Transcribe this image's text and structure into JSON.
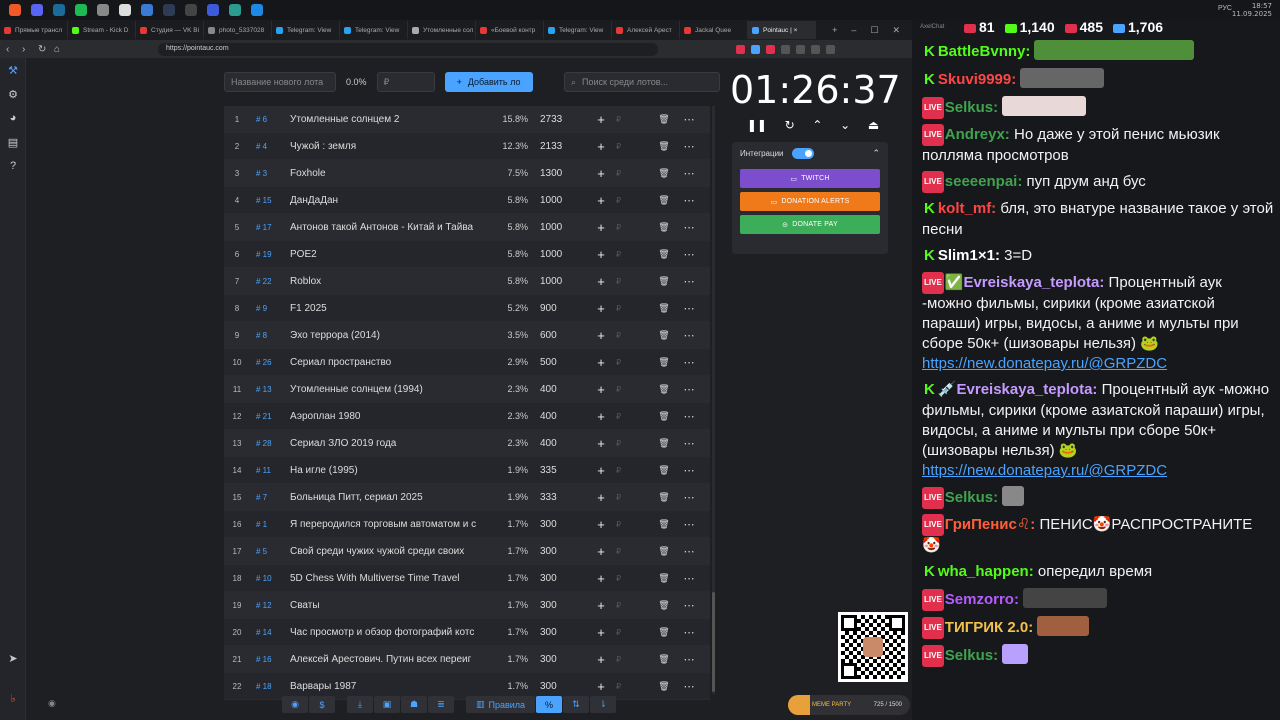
{
  "taskbar": {
    "lang": "РУС",
    "time": "18:57",
    "date": "11.09.2025",
    "icons": [
      {
        "name": "brave-icon",
        "color": "#f05a28"
      },
      {
        "name": "discord-icon",
        "color": "#5865f2"
      },
      {
        "name": "steam-icon",
        "color": "#1b6a9c"
      },
      {
        "name": "spotify-icon",
        "color": "#1db954"
      },
      {
        "name": "app-icon",
        "color": "#888"
      },
      {
        "name": "close-app-icon",
        "color": "#ddd"
      },
      {
        "name": "app-icon",
        "color": "#3a7bd5"
      },
      {
        "name": "app-icon",
        "color": "#2e3b55"
      },
      {
        "name": "app-icon",
        "color": "#444"
      },
      {
        "name": "app-icon",
        "color": "#3b5bdb"
      },
      {
        "name": "app-icon",
        "color": "#2a9d8f"
      },
      {
        "name": "app-icon",
        "color": "#1e88e5"
      }
    ]
  },
  "browser": {
    "tabs": [
      {
        "label": "Прямые трансл",
        "color": "#e53935"
      },
      {
        "label": "Stream - Kick D",
        "color": "#53fc18"
      },
      {
        "label": "Студия — VK Ві",
        "color": "#e53935"
      },
      {
        "label": "photo_5337028",
        "color": "#888"
      },
      {
        "label": "Telegram: View",
        "color": "#2aa3ef"
      },
      {
        "label": "Telegram: View",
        "color": "#2aa3ef"
      },
      {
        "label": "Утомленные сол",
        "color": "#aaa"
      },
      {
        "label": "«Боевой контр",
        "color": "#e53935"
      },
      {
        "label": "Telegram: View",
        "color": "#2aa3ef"
      },
      {
        "label": "Алексей Арест",
        "color": "#e53935"
      },
      {
        "label": "Jackal Quee",
        "color": "#e53935"
      },
      {
        "label": "Pointauc | ×",
        "color": "#4aa3ff"
      }
    ],
    "url": "https://pointauc.com"
  },
  "auction": {
    "new_lot_placeholder": "Название нового лота",
    "pct": "0.0%",
    "amount_placeholder": "₽",
    "add_label": "Добавить ло",
    "search_placeholder": "Поиск среди лотов...",
    "currency": "₽",
    "lots": [
      {
        "idx": "1",
        "id": "# 6",
        "name": "Утомленные солнцем 2",
        "pct": "15.8%",
        "amount": "2733"
      },
      {
        "idx": "2",
        "id": "# 4",
        "name": "Чужой : земля",
        "pct": "12.3%",
        "amount": "2133"
      },
      {
        "idx": "3",
        "id": "# 3",
        "name": "Foxhole",
        "pct": "7.5%",
        "amount": "1300"
      },
      {
        "idx": "4",
        "id": "# 15",
        "name": "ДанДаДан",
        "pct": "5.8%",
        "amount": "1000"
      },
      {
        "idx": "5",
        "id": "# 17",
        "name": "Антонов такой Антонов - Китай и Тайва",
        "pct": "5.8%",
        "amount": "1000"
      },
      {
        "idx": "6",
        "id": "# 19",
        "name": "POE2",
        "pct": "5.8%",
        "amount": "1000"
      },
      {
        "idx": "7",
        "id": "# 22",
        "name": "Roblox",
        "pct": "5.8%",
        "amount": "1000"
      },
      {
        "idx": "8",
        "id": "# 9",
        "name": "F1 2025",
        "pct": "5.2%",
        "amount": "900"
      },
      {
        "idx": "9",
        "id": "# 8",
        "name": "Эхо террора (2014)",
        "pct": "3.5%",
        "amount": "600"
      },
      {
        "idx": "10",
        "id": "# 26",
        "name": "Сериал пространство",
        "pct": "2.9%",
        "amount": "500"
      },
      {
        "idx": "11",
        "id": "# 13",
        "name": "Утомленные солнцем (1994)",
        "pct": "2.3%",
        "amount": "400"
      },
      {
        "idx": "12",
        "id": "# 21",
        "name": "Аэроплан 1980",
        "pct": "2.3%",
        "amount": "400"
      },
      {
        "idx": "13",
        "id": "# 28",
        "name": "Сериал ЗЛО 2019 года",
        "pct": "2.3%",
        "amount": "400"
      },
      {
        "idx": "14",
        "id": "# 11",
        "name": "На игле (1995)",
        "pct": "1.9%",
        "amount": "335"
      },
      {
        "idx": "15",
        "id": "# 7",
        "name": "Больница Питт, сериал 2025",
        "pct": "1.9%",
        "amount": "333"
      },
      {
        "idx": "16",
        "id": "# 1",
        "name": "Я переродился торговым автоматом и с",
        "pct": "1.7%",
        "amount": "300"
      },
      {
        "idx": "17",
        "id": "# 5",
        "name": "Свой среди чужих чужой среди своих",
        "pct": "1.7%",
        "amount": "300"
      },
      {
        "idx": "18",
        "id": "# 10",
        "name": "5D Chess With Multiverse Time Travel",
        "pct": "1.7%",
        "amount": "300"
      },
      {
        "idx": "19",
        "id": "# 12",
        "name": "Сваты",
        "pct": "1.7%",
        "amount": "300"
      },
      {
        "idx": "20",
        "id": "# 14",
        "name": "Час просмотр и обзор фотографий котс",
        "pct": "1.7%",
        "amount": "300"
      },
      {
        "idx": "21",
        "id": "# 16",
        "name": "Алексей Арестович. Путин всех переиг",
        "pct": "1.7%",
        "amount": "300"
      },
      {
        "idx": "22",
        "id": "# 18",
        "name": "Варвары 1987",
        "pct": "1.7%",
        "amount": "300"
      }
    ],
    "timer": "01:26:37",
    "integrations_label": "Интеграции",
    "twitch_label": "TWITCH",
    "donation_alerts_label": "DONATION ALERTS",
    "donatepay_label": "DONATE PAY",
    "rules_label": "Правила",
    "percent_label": "%",
    "meme_label": "MEME PARTY",
    "meme_count": "725 / 1500",
    "colors": {
      "accent": "#4aa3ff",
      "twitch": "#7c4dcc",
      "donation_alerts": "#f07a1a",
      "donatepay": "#3cae5a"
    }
  },
  "chat": {
    "app_label": "AxelChat",
    "stats": [
      {
        "value": "81",
        "color": "#e0304e"
      },
      {
        "value": "1,140",
        "color": "#53fc18"
      },
      {
        "value": "485",
        "color": "#e0304e"
      },
      {
        "value": "1,706",
        "color": "#4aa3ff"
      }
    ],
    "live_badge": "LIVE",
    "kick_badge": "K",
    "messages": [
      {
        "platform": "kick",
        "user": "BattleBvnny:",
        "color": "#53fc18",
        "text": "",
        "emote": "#4f8f3a",
        "emote_w": 160
      },
      {
        "platform": "kick",
        "user": "Skuvi9999:",
        "color": "#ff4545",
        "text": "",
        "emote": "#666",
        "emote_w": 84
      },
      {
        "platform": "live",
        "user": "Selkus:",
        "color": "#3fa34d",
        "text": "",
        "emote": "#e8d8d8",
        "emote_w": 84
      },
      {
        "platform": "live",
        "user": "Andreyx:",
        "color": "#3fa34d",
        "text": "Но даже у этой пенис мьюзик полляма просмотров"
      },
      {
        "platform": "live",
        "user": "seeeenpai:",
        "color": "#3fa34d",
        "text": "пуп друм анд бус"
      },
      {
        "platform": "kick",
        "user": "kolt_mf:",
        "color": "#ff4545",
        "text": "бля, это внатуре название такое у этой песни"
      },
      {
        "platform": "kick",
        "user": "Slim1×1:",
        "color": "#fff",
        "text": "3=D"
      },
      {
        "platform": "live",
        "user": "✅Evreiskaya_teplota:",
        "color": "#c59bff",
        "text": "Процентный аук -можно фильмы, сирики (кроме азиатской параши) игры, видосы, а аниме и мульты при сборе 50к+ (шизовары нельзя) 🐸",
        "link": "https://new.donatepay.ru/@GRPZDC"
      },
      {
        "platform": "kick",
        "user": "💉Evreiskaya_teplota:",
        "color": "#c59bff",
        "text": "Процентный аук -можно фильмы, сирики (кроме азиатской параши) игры, видосы, а аниме и мульты при сборе 50к+ (шизовары нельзя) 🐸",
        "link": "https://new.donatepay.ru/@GRPZDC"
      },
      {
        "platform": "live",
        "user": "Selkus:",
        "color": "#3fa34d",
        "text": "",
        "emote": "#888",
        "emote_w": 22
      },
      {
        "platform": "live",
        "user": "ГриПенис♌:",
        "color": "#ff5e3a",
        "text": "ПЕНИС🤡РАСПРОСТРАНИТЕ 🤡"
      },
      {
        "platform": "kick",
        "user": "wha_happen:",
        "color": "#53fc18",
        "text": "опередил время"
      },
      {
        "platform": "live",
        "user": "Semzorro:",
        "color": "#b65cff",
        "text": "",
        "emote": "#444",
        "emote_w": 84
      },
      {
        "platform": "live",
        "user": "ТИГРИК 2.0:",
        "color": "#f3c14a",
        "text": "",
        "emote": "#a06040",
        "emote_w": 52
      },
      {
        "platform": "live",
        "user": "Selkus:",
        "color": "#3fa34d",
        "text": "",
        "emote": "#b8a0ff",
        "emote_w": 26
      }
    ]
  }
}
